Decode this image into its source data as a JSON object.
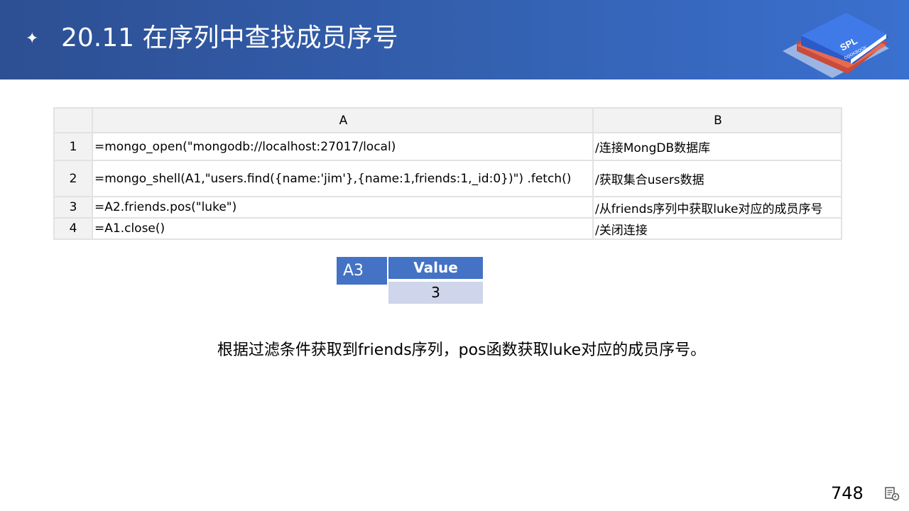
{
  "header": {
    "title": "20.11 在序列中查找成员序号",
    "logo_text": "SPL",
    "logo_subtext": "COOKBOOK"
  },
  "grid": {
    "col_headers": [
      "A",
      "B"
    ],
    "rows": [
      {
        "num": "1",
        "code": "=mongo_open(\"mongodb://localhost:27017/local)",
        "comment": "/连接MongDB数据库"
      },
      {
        "num": "2",
        "code": "=mongo_shell(A1,\"users.find({name:'jim'},{name:1,friends:1,_id:0})\")  .fetch()",
        "comment": "/获取集合users数据"
      },
      {
        "num": "3",
        "code": "=A2.friends.pos(\"luke\")",
        "comment": "/从friends序列中获取luke对应的成员序号"
      },
      {
        "num": "4",
        "code": "=A1.close()",
        "comment": "/关闭连接"
      }
    ]
  },
  "result": {
    "cell": "A3",
    "header": "Value",
    "value": "3"
  },
  "description": "根据过滤条件获取到friends序列，pos函数获取luke对应的成员序号。",
  "page_number": "748",
  "colors": {
    "header_bg": "#3461b1",
    "accent": "#4472c4",
    "value_bg": "#cfd5ea",
    "grid_border": "#e2e2e2"
  }
}
